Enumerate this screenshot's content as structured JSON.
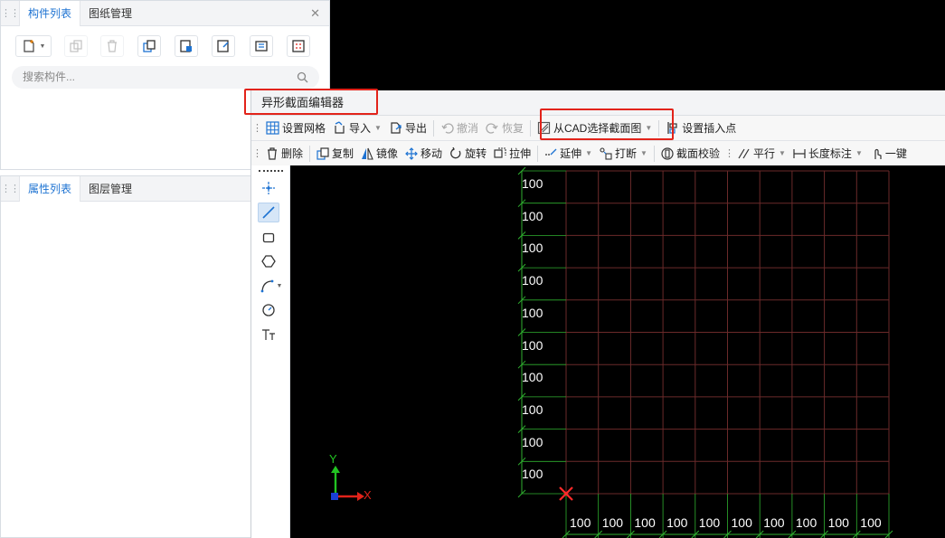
{
  "left_top_panel": {
    "tabs": [
      "构件列表",
      "图纸管理"
    ],
    "close_icon": "close-icon",
    "toolbar_icons": [
      "new-component-icon",
      "copy-icon",
      "delete-icon",
      "copy-floor-icon",
      "layer-copy-icon",
      "batch-icon",
      "properties-icon",
      "list-icon"
    ],
    "search_placeholder": "搜索构件..."
  },
  "left_bottom_panel": {
    "tabs": [
      "属性列表",
      "图层管理"
    ]
  },
  "editor": {
    "title": "异形截面编辑器",
    "toolbar1": [
      {
        "icon": "grid-icon",
        "label": "设置网格",
        "enabled": true
      },
      {
        "icon": "import-icon",
        "label": "导入",
        "enabled": true,
        "dropdown": true
      },
      {
        "icon": "export-icon",
        "label": "导出",
        "enabled": true
      },
      {
        "icon": "undo-icon",
        "label": "撤消",
        "enabled": false
      },
      {
        "icon": "redo-icon",
        "label": "恢复",
        "enabled": false
      },
      {
        "icon": "cad-select-icon",
        "label": "从CAD选择截面图",
        "enabled": true,
        "dropdown": true
      },
      {
        "icon": "insert-point-icon",
        "label": "设置插入点",
        "enabled": true
      }
    ],
    "toolbar2": [
      {
        "icon": "delete-icon",
        "label": "删除"
      },
      {
        "icon": "copy-icon",
        "label": "复制"
      },
      {
        "icon": "mirror-icon",
        "label": "镜像"
      },
      {
        "icon": "move-icon",
        "label": "移动"
      },
      {
        "icon": "rotate-icon",
        "label": "旋转"
      },
      {
        "icon": "stretch-icon",
        "label": "拉伸"
      },
      {
        "icon": "extend-icon",
        "label": "延伸",
        "dropdown": true
      },
      {
        "icon": "break-icon",
        "label": "打断",
        "dropdown": true
      },
      {
        "icon": "section-check-icon",
        "label": "截面校验"
      },
      {
        "icon": "parallel-icon",
        "label": "平行",
        "dropdown": true
      },
      {
        "icon": "length-dim-icon",
        "label": "长度标注",
        "dropdown": true
      },
      {
        "icon": "one-click-icon",
        "label": "一键"
      }
    ],
    "draw_tools": [
      "point-icon",
      "line-icon",
      "rectangle-icon",
      "polygon-icon",
      "arc-icon",
      "circle-icon",
      "text-icon"
    ],
    "grid": {
      "row_labels": [
        "100",
        "100",
        "100",
        "100",
        "100",
        "100",
        "100",
        "100",
        "100",
        "100"
      ],
      "col_labels": [
        "100",
        "100",
        "100",
        "100",
        "100",
        "100",
        "100",
        "100",
        "100",
        "100"
      ]
    },
    "axis": {
      "x": "X",
      "y": "Y"
    },
    "colors": {
      "grid_line": "#6b2a2a",
      "dim_line": "#2fb02f",
      "origin_marker": "#ff2a2a",
      "highlight": "#e2231a"
    }
  }
}
